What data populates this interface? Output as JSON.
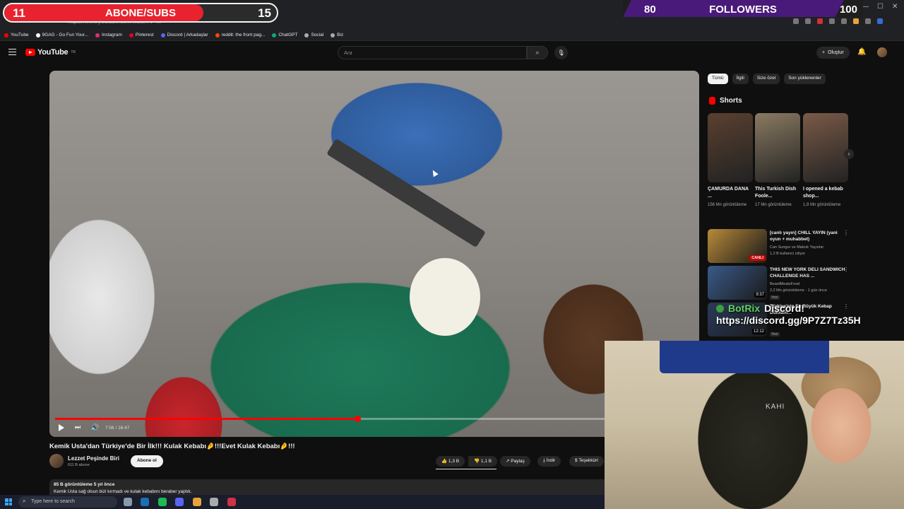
{
  "overlay": {
    "subs": {
      "current": "11",
      "title": "ABONE/SUBS",
      "goal": "15",
      "progress": 0.73,
      "color": "#e8232f"
    },
    "followers": {
      "current": "80",
      "title": "FOLLOWERS",
      "goal": "100",
      "progress": 0.92,
      "color": "#4a1a7a"
    },
    "bot": {
      "name": "BotRix",
      "message": "Discord!",
      "link": "https://discord.gg/9P7Z7Tz35H"
    },
    "webcam_chair_text": "KAHI"
  },
  "browser": {
    "url": "https://www.youtube.com/watch?v=...",
    "bookmarks": [
      {
        "label": "YouTube",
        "icon": "youtube-icon",
        "color": "#ff0000"
      },
      {
        "label": "9GAG - Go Fun Your...",
        "icon": "9gag-icon",
        "color": "#ffffff"
      },
      {
        "label": "Instagram",
        "icon": "instagram-icon",
        "color": "#e1306c"
      },
      {
        "label": "Pinterest",
        "icon": "pinterest-icon",
        "color": "#e60023"
      },
      {
        "label": "Discord | Arkadaşlar",
        "icon": "discord-icon",
        "color": "#5865f2"
      },
      {
        "label": "reddit: the front pag...",
        "icon": "reddit-icon",
        "color": "#ff4500"
      },
      {
        "label": "ChatGPT",
        "icon": "chatgpt-icon",
        "color": "#10a37f"
      },
      {
        "label": "Social",
        "icon": "folder-icon",
        "color": "#aaaaaa"
      },
      {
        "label": "Biz",
        "icon": "folder-icon",
        "color": "#aaaaaa"
      }
    ]
  },
  "header": {
    "logo": "YouTube",
    "logo_country": "TR",
    "search_placeholder": "Ara",
    "create_label": "Oluştur"
  },
  "player": {
    "time": "7:56 / 16:47",
    "progress": 0.473
  },
  "video": {
    "title": "Kemik Usta'dan Türkiye'de Bir İlk!!! Kulak Kebabı🤌!!!Evet Kulak Kebabı🤌!!!",
    "channel": "Lezzet Peşinde Biri",
    "subscribers": "611 B abone",
    "subscribe_label": "Abone ol",
    "likes": "1,3 B",
    "dislikes": "1,1 B",
    "share_label": "Paylaş",
    "download_label": "İndir",
    "thanks_label": "Teşekkürl",
    "views_line": "85 B görüntüleme  5 yıl önce",
    "description": "Kemik Usta sağ olsun bizi kırmadı ve kulak kebabını beraber yaptık."
  },
  "chips": [
    "Tümü",
    "İlgili",
    "Size özel",
    "Son yüklenenler"
  ],
  "shorts": {
    "title": "Shorts",
    "items": [
      {
        "title": "ÇAMURDA DANA ...",
        "views": "156 Mn görüntüleme",
        "color": "#5a4030"
      },
      {
        "title": "This Turkish Dish Foole...",
        "views": "17 Mn görüntüleme",
        "color": "#8a7a62"
      },
      {
        "title": "I opened a kebab shop...",
        "views": "1,9 Mn görüntüleme",
        "color": "#7a5a48"
      }
    ]
  },
  "recommended": [
    {
      "title": "[canlı yayın] CHILL YAYIN (yani oyun + muhabbet)",
      "channel": "Can Sungur ve Matruk Yayınlar",
      "meta": "1,2 B kullanıcı izliyor",
      "badge": "CANLI",
      "color": "#b88a3a"
    },
    {
      "title": "THIS NEW YORK DELI SANDWICH CHALLENGE HAS ...",
      "channel": "BeardMeatsFood",
      "meta": "2,2 Mn görüntüleme · 1 gün önce",
      "duration": "9:37",
      "new": "Yeni",
      "color": "#3a5a8a"
    },
    {
      "title": "Türkiye'nin En Büyük Kebap Dükkânı...",
      "channel": "",
      "meta": "",
      "duration": "12:12",
      "new": "Yeni",
      "color": "#2a3a5a"
    }
  ],
  "taskbar": {
    "search_placeholder": "Type here to search",
    "apps": [
      {
        "icon": "task-view-icon",
        "color": "#8899aa"
      },
      {
        "icon": "steam-icon",
        "color": "#1b6fb5"
      },
      {
        "icon": "spotify-icon",
        "color": "#1db954"
      },
      {
        "icon": "discord-icon",
        "color": "#5865f2"
      },
      {
        "icon": "chrome-icon",
        "color": "#e8a23a"
      },
      {
        "icon": "settings-icon",
        "color": "#aaaaaa"
      },
      {
        "icon": "obs-icon",
        "color": "#cc3344"
      }
    ]
  }
}
